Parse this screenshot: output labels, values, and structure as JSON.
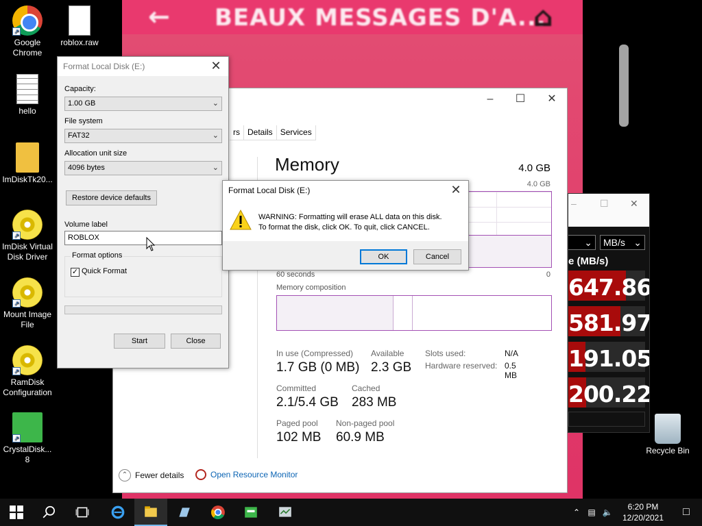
{
  "wallpaper": {
    "banner_title": "BEAUX MESSAGES D'A...",
    "back_icon": "left-arrow-icon",
    "home_icon": "home-icon"
  },
  "desktop_icons": [
    {
      "label": "Google Chrome",
      "icon": "chrome-icon"
    },
    {
      "label": "roblox.raw",
      "icon": "file-icon"
    },
    {
      "label": "hello",
      "icon": "text-file-icon"
    },
    {
      "label": "ImDiskTk20...",
      "icon": "folder-icon"
    },
    {
      "label": "ImDisk Virtual Disk Driver",
      "icon": "disc-icon"
    },
    {
      "label": "Mount Image File",
      "icon": "disc-icon"
    },
    {
      "label": "RamDisk Configuration",
      "icon": "disc-icon"
    },
    {
      "label": "CrystalDisk... 8",
      "icon": "crystaldisk-icon"
    },
    {
      "label": "Recycle Bin",
      "icon": "recycle-bin-icon"
    }
  ],
  "task_manager": {
    "tabs": [
      "rs",
      "Details",
      "Services"
    ],
    "memory": {
      "title": "Memory",
      "total": "4.0 GB",
      "graph_max": "4.0 GB",
      "graph_time": "60 seconds",
      "graph_min": "0",
      "composition_label": "Memory composition",
      "in_use_fraction": 0.425,
      "modified_fraction": 0.07
    },
    "stats": {
      "in_use": {
        "label": "In use (Compressed)",
        "value": "1.7 GB (0 MB)"
      },
      "available": {
        "label": "Available",
        "value": "2.3 GB"
      },
      "committed": {
        "label": "Committed",
        "value": "2.1/5.4 GB"
      },
      "cached": {
        "label": "Cached",
        "value": "283 MB"
      },
      "paged_pool": {
        "label": "Paged pool",
        "value": "102 MB"
      },
      "non_paged_pool": {
        "label": "Non-paged pool",
        "value": "60.9 MB"
      }
    },
    "kv": {
      "slots_used": {
        "label": "Slots used:",
        "value": "N/A"
      },
      "hardware_reserved": {
        "label": "Hardware reserved:",
        "value": "0.5 MB"
      }
    },
    "fewer_details": "Fewer details",
    "open_resource_monitor": "Open Resource Monitor"
  },
  "disk_speed": {
    "unit": "MB/s",
    "rate_label": "e (MB/s)",
    "rows": [
      {
        "value": "647.86",
        "fill": 0.75
      },
      {
        "value": "581.97",
        "fill": 0.68
      },
      {
        "value": "191.05",
        "fill": 0.22
      },
      {
        "value": "200.22",
        "fill": 0.23
      }
    ]
  },
  "format_dialog": {
    "title": "Format Local Disk (E:)",
    "capacity_label": "Capacity:",
    "capacity_value": "1.00 GB",
    "fs_label": "File system",
    "fs_value": "FAT32",
    "alloc_label": "Allocation unit size",
    "alloc_value": "4096 bytes",
    "restore_button": "Restore device defaults",
    "volume_label": "Volume label",
    "volume_value": "ROBLOX",
    "format_options": "Format options",
    "quick_format": "Quick Format",
    "quick_format_checked": true,
    "start_button": "Start",
    "close_button": "Close"
  },
  "warning_dialog": {
    "title": "Format Local Disk (E:)",
    "line1": "WARNING: Formatting will erase ALL data on this disk.",
    "line2": "To format the disk, click OK. To quit, click CANCEL.",
    "ok": "OK",
    "cancel": "Cancel"
  },
  "taskbar": {
    "time": "6:20 PM",
    "date": "12/20/2021",
    "apps": [
      "start-icon",
      "search-icon",
      "task-view-icon",
      "internet-explorer-icon",
      "file-explorer-icon",
      "notepad-icon",
      "chrome-icon",
      "disk-tool-icon",
      "task-manager-icon"
    ]
  }
}
